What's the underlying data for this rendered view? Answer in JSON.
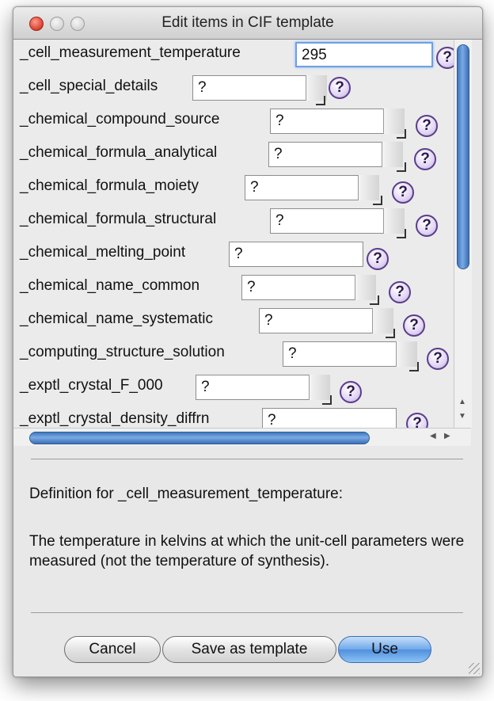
{
  "window": {
    "title": "Edit items in CIF template"
  },
  "items": [
    {
      "label": "_cell_measurement_temperature",
      "value": "295"
    },
    {
      "label": "_cell_special_details",
      "value": "?"
    },
    {
      "label": "_chemical_compound_source",
      "value": "?"
    },
    {
      "label": "_chemical_formula_analytical",
      "value": "?"
    },
    {
      "label": "_chemical_formula_moiety",
      "value": "?"
    },
    {
      "label": "_chemical_formula_structural",
      "value": "?"
    },
    {
      "label": "_chemical_melting_point",
      "value": "?"
    },
    {
      "label": "_chemical_name_common",
      "value": "?"
    },
    {
      "label": "_chemical_name_systematic",
      "value": "?"
    },
    {
      "label": "_computing_structure_solution",
      "value": "?"
    },
    {
      "label": "_exptl_crystal_F_000",
      "value": "?"
    },
    {
      "label": "_exptl_crystal_density_diffrn",
      "value": "?"
    }
  ],
  "help_glyph": "?",
  "scroll": {
    "up": "▲",
    "down": "▼",
    "left": "◀",
    "right": "▶"
  },
  "definition": {
    "heading": "Definition for _cell_measurement_temperature:",
    "text": "The temperature in kelvins at which the unit-cell parameters were measured (not the temperature of synthesis)."
  },
  "buttons": {
    "cancel": "Cancel",
    "save_template": "Save as template",
    "use": "Use"
  },
  "icons": {
    "help": "help-icon",
    "resize": "resize-grip-icon"
  }
}
